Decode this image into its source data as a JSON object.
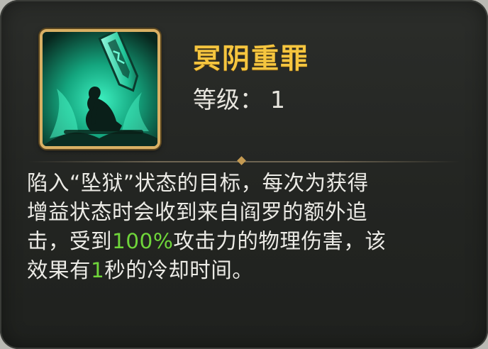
{
  "skill": {
    "name": "冥阴重罪",
    "level_label": "等级：",
    "level_value": "1",
    "icon": "kneeling-figure-with-green-crystal-icon"
  },
  "description": {
    "line1": "陷入“坠狱”状态的目标，每次为获得",
    "line2": "增益状态时会收到来自阎罗的额外追",
    "line3_a": "击，受到",
    "line3_highlight": "100%",
    "line3_b": "攻击力的物理伤害，该",
    "line4_a": "效果有",
    "line4_highlight": "1",
    "line4_b": "秒的冷却时间。"
  },
  "colors": {
    "title": "#f5c53f",
    "highlight": "#6fd53a",
    "frame": "#d9b064",
    "panel": "#252724"
  }
}
